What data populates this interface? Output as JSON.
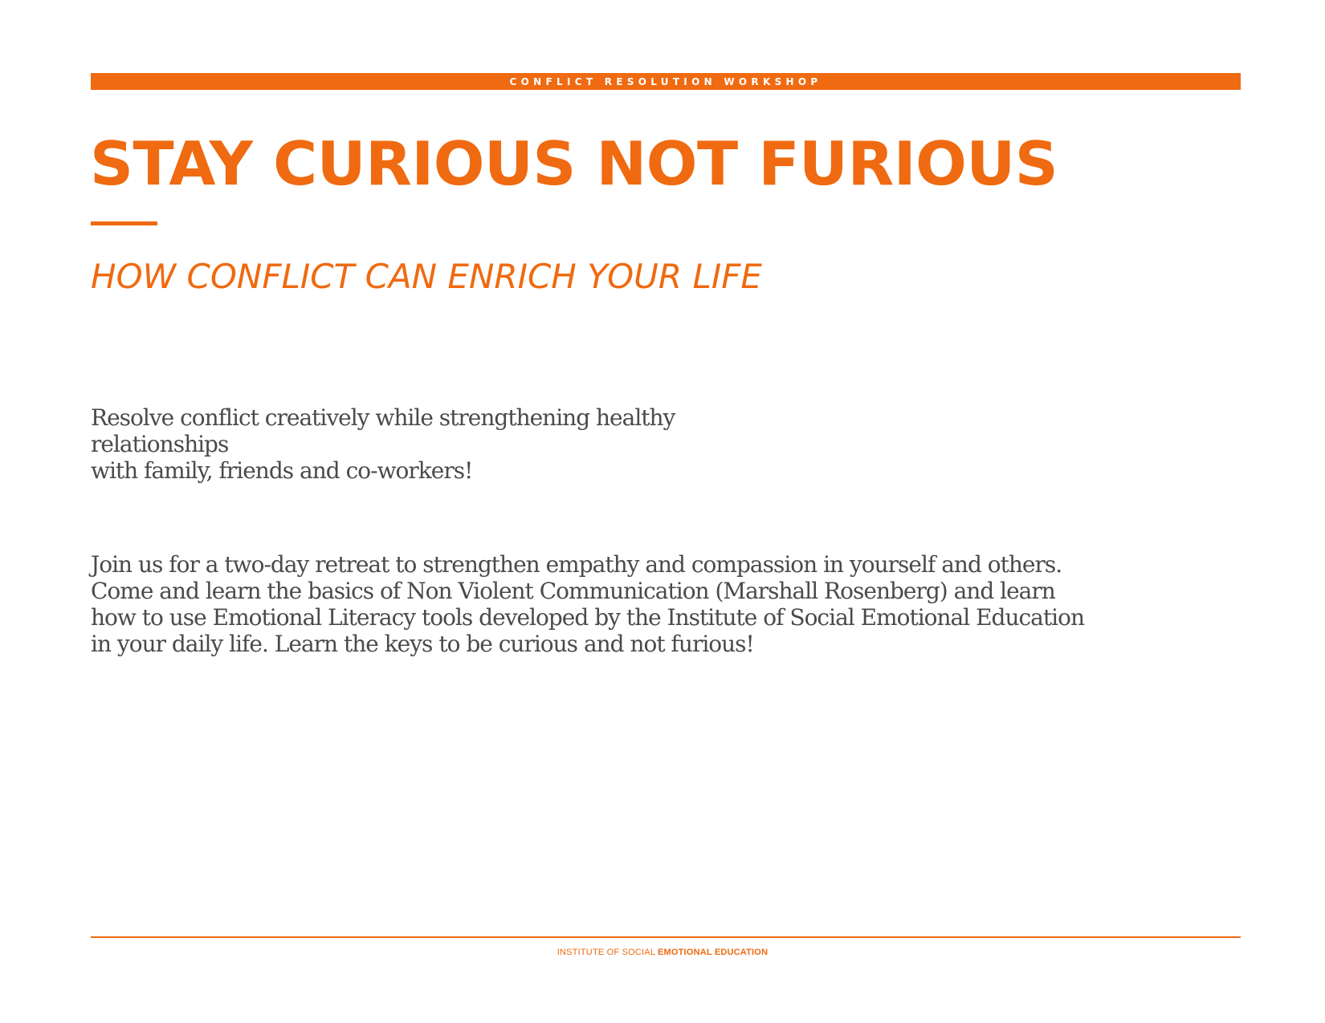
{
  "header": {
    "banner_text": "CONFLICT RESOLUTION WORKSHOP"
  },
  "hero": {
    "title": "STAY CURIOUS NOT FURIOUS",
    "subtitle": "HOW CONFLICT CAN ENRICH YOUR LIFE"
  },
  "content": {
    "tagline_lines": [
      "Resolve conflict creatively while strengthening healthy relationships",
      "with family, friends and co-workers!"
    ],
    "description_lines": [
      "Join us for a two-day retreat to strengthen empathy and compassion in yourself and others.",
      "Come and learn the basics of Non Violent Communication (Marshall Rosenberg) and learn",
      "how to use Emotional Literacy tools developed by the Institute of Social Emotional Education",
      "in your daily life. Learn the keys to be curious and not furious!"
    ]
  },
  "footer": {
    "org_prefix": "INSTITUTE OF SOCIAL ",
    "org_emphasis": "EMOTIONAL EDUCATION"
  },
  "colors": {
    "accent": "#ef6a10",
    "body_text": "#4a4a4a",
    "background": "#ffffff"
  }
}
